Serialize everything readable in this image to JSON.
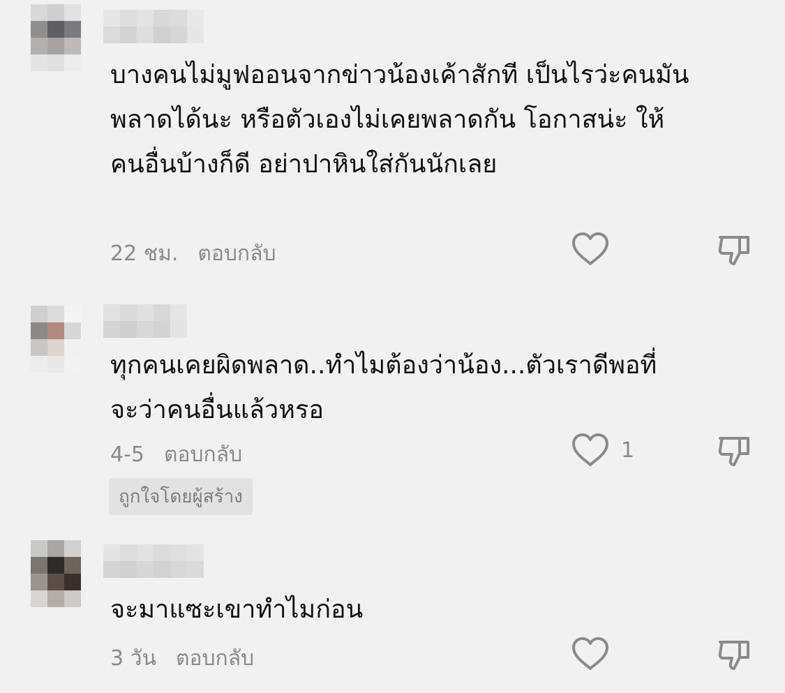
{
  "comments": [
    {
      "text": "บางคนไม่มูฟออนจากข่าวน้องเค้าสักที เป็นไรว่ะคนมันพลาดได้นะ หรือตัวเองไม่เคยพลาดกัน โอกาสน่ะ ให้คนอื่นบ้างก็ดี อย่าปาหินใส่กันนักเลย",
      "time": "22 ชม.",
      "reply_label": "ตอบกลับ",
      "like_count": "",
      "badge": ""
    },
    {
      "text": "ทุกคนเคยผิดพลาด..ทำไมต้องว่าน้อง...ตัวเราดีพอที่จะว่าคนอื่นแล้วหรอ",
      "time": "4-5",
      "reply_label": "ตอบกลับ",
      "like_count": "1",
      "badge": "ถูกใจโดยผู้สร้าง"
    },
    {
      "text": "จะมาแซะเขาทำไมก่อน",
      "time": "3 วัน",
      "reply_label": "ตอบกลับ",
      "like_count": "",
      "badge": ""
    }
  ],
  "icons": {
    "like": "heart-outline-icon",
    "dislike": "thumbs-down-outline-icon"
  },
  "colors": {
    "background": "#f1f1f1",
    "text": "#111111",
    "meta": "#8a8a8a",
    "badge_bg": "#e2e2e2"
  }
}
